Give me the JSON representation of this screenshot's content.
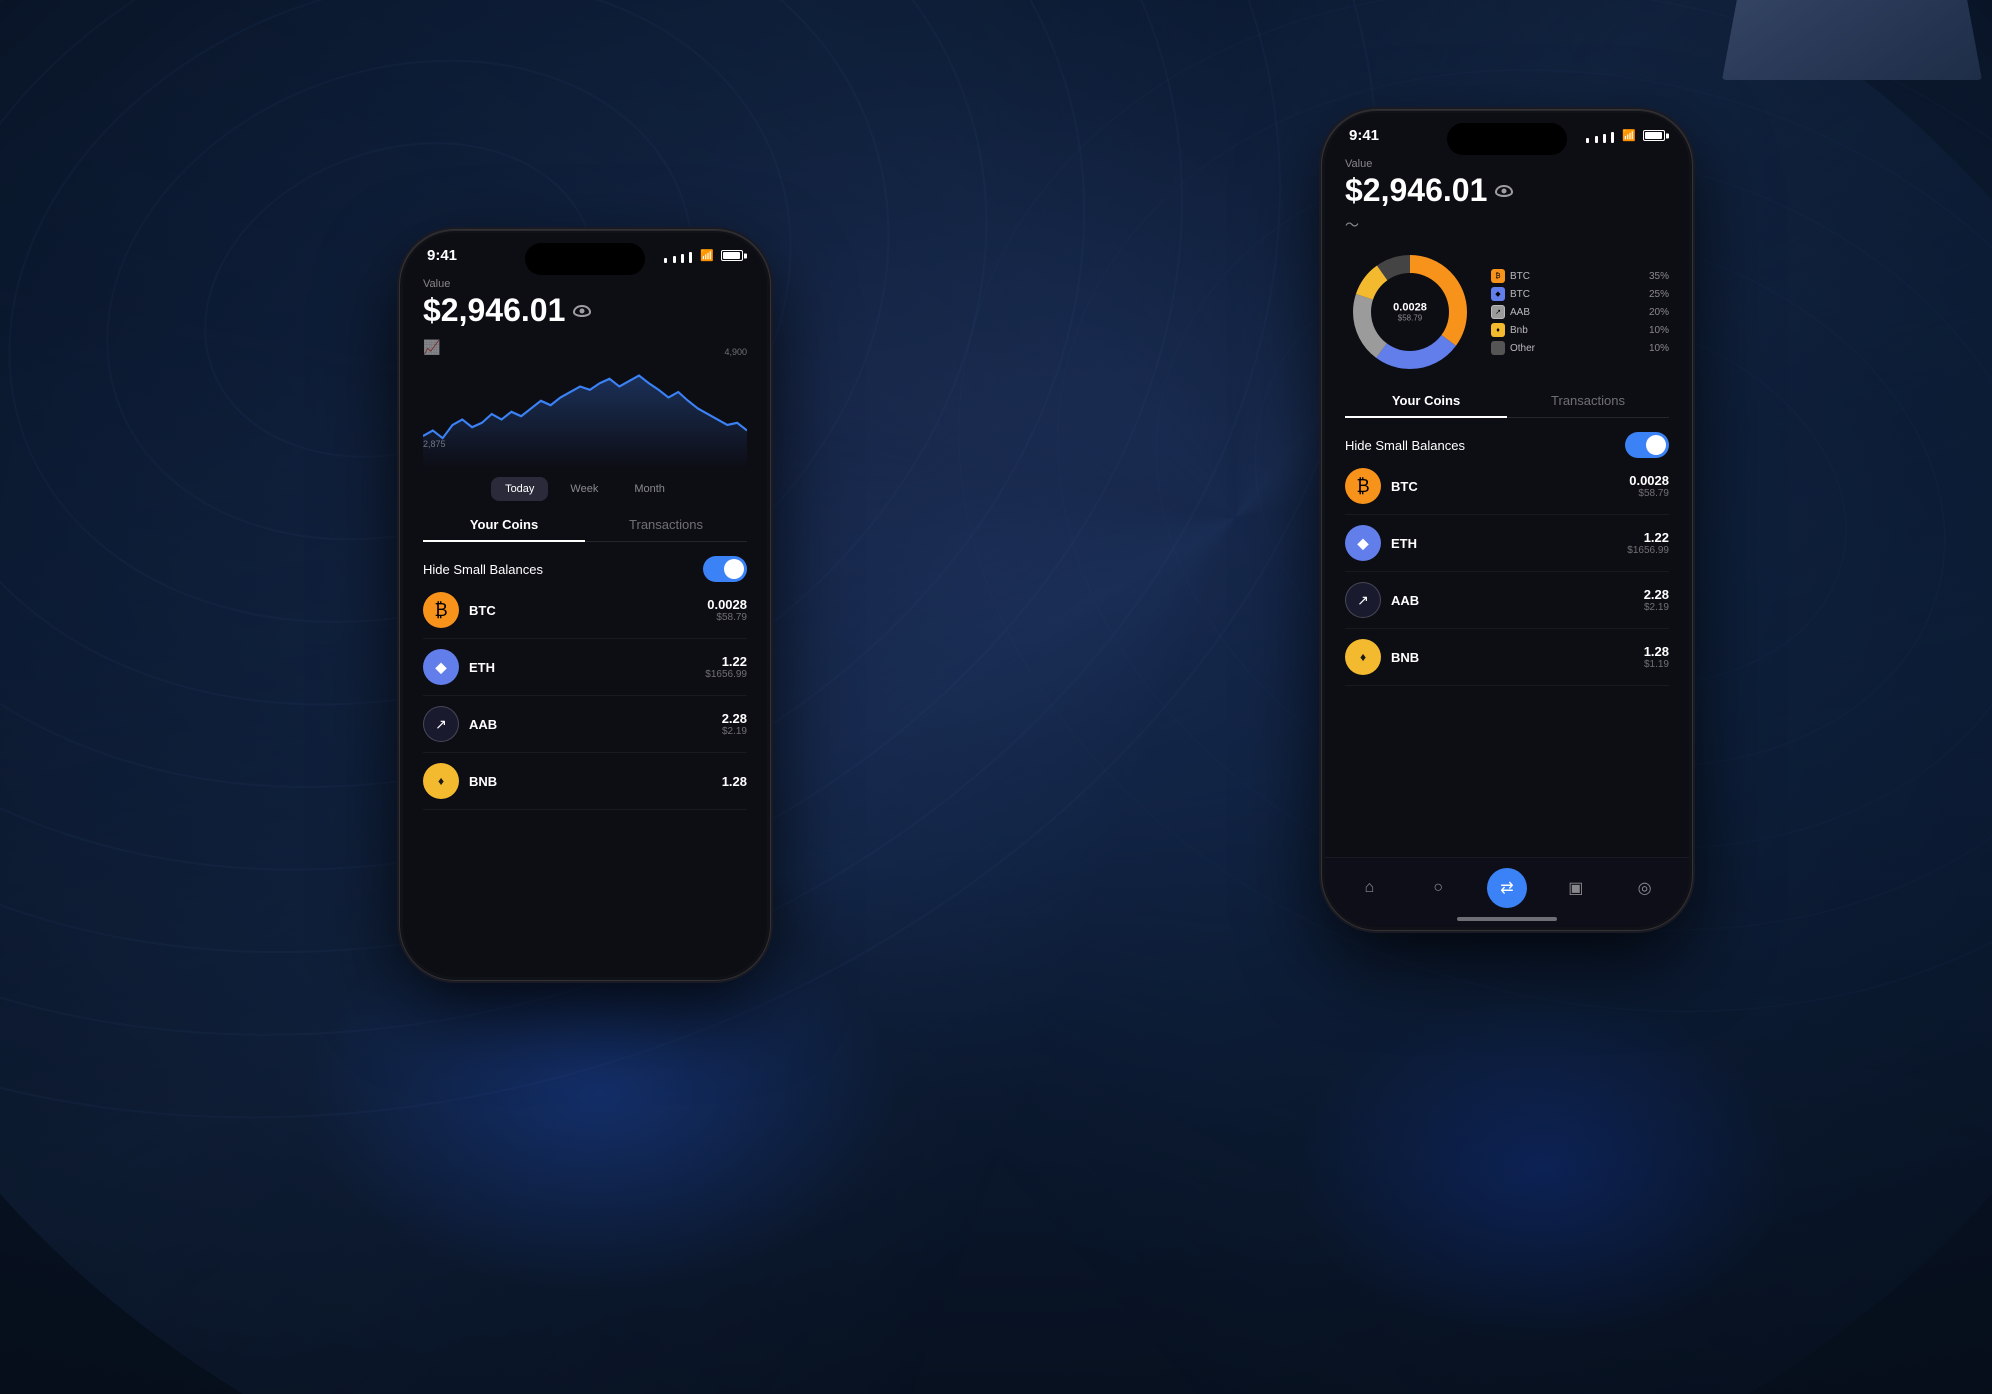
{
  "background": {
    "base_color": "#0a1628"
  },
  "left_phone": {
    "status": {
      "time": "9:41",
      "signal_bars": 4,
      "wifi": true,
      "battery": 100
    },
    "value_label": "Value",
    "value_amount": "$2,946.01",
    "chart": {
      "high_value": "4,900",
      "low_value": "2,875"
    },
    "time_filters": [
      {
        "label": "Today",
        "active": true
      },
      {
        "label": "Week",
        "active": false
      },
      {
        "label": "Month",
        "active": false
      }
    ],
    "tabs": [
      {
        "label": "Your Coins",
        "active": true
      },
      {
        "label": "Transactions",
        "active": false
      }
    ],
    "hide_balances_label": "Hide Small Balances",
    "toggle_on": true,
    "coins": [
      {
        "symbol": "BTC",
        "type": "btc",
        "amount": "0.0028",
        "usd": "$58.79"
      },
      {
        "symbol": "ETH",
        "type": "eth",
        "amount": "1.22",
        "usd": "$1656.99"
      },
      {
        "symbol": "AAB",
        "type": "aab",
        "amount": "2.28",
        "usd": "$2.19"
      },
      {
        "symbol": "BNB",
        "type": "bnb",
        "amount": "1.28",
        "usd": ""
      }
    ]
  },
  "right_phone": {
    "status": {
      "time": "9:41",
      "signal_bars": 4,
      "wifi": true,
      "battery": 100
    },
    "value_label": "Value",
    "value_amount": "$2,946.01",
    "donut": {
      "center_amount": "0.0028",
      "center_usd": "$58.79",
      "segments": [
        {
          "label": "BTC",
          "pct": 35,
          "color": "#f7931a",
          "type": "btc"
        },
        {
          "label": "BTC",
          "pct": 25,
          "color": "#627eea",
          "type": "eth"
        },
        {
          "label": "AAB",
          "pct": 20,
          "color": "#9b9b9b",
          "type": "aab"
        },
        {
          "label": "Bnb",
          "pct": 10,
          "color": "#f3ba2f",
          "type": "bnb"
        },
        {
          "label": "Other",
          "pct": 10,
          "color": "#555",
          "type": "other"
        }
      ]
    },
    "tabs": [
      {
        "label": "Your Coins",
        "active": true
      },
      {
        "label": "Transactions",
        "active": false
      }
    ],
    "hide_balances_label": "Hide Small Balances",
    "toggle_on": true,
    "coins": [
      {
        "symbol": "BTC",
        "type": "btc",
        "amount": "0.0028",
        "usd": "$58.79"
      },
      {
        "symbol": "ETH",
        "type": "eth",
        "amount": "1.22",
        "usd": "$1656.99"
      },
      {
        "symbol": "AAB",
        "type": "aab",
        "amount": "2.28",
        "usd": "$2.19"
      },
      {
        "symbol": "BNB",
        "type": "bnb",
        "amount": "1.28",
        "usd": "$1.19"
      }
    ],
    "nav": [
      {
        "icon": "🏠",
        "active": false
      },
      {
        "icon": "👤",
        "active": false
      },
      {
        "icon": "⇄",
        "active": true
      },
      {
        "icon": "💼",
        "active": false
      },
      {
        "icon": "⊙",
        "active": false
      }
    ]
  }
}
